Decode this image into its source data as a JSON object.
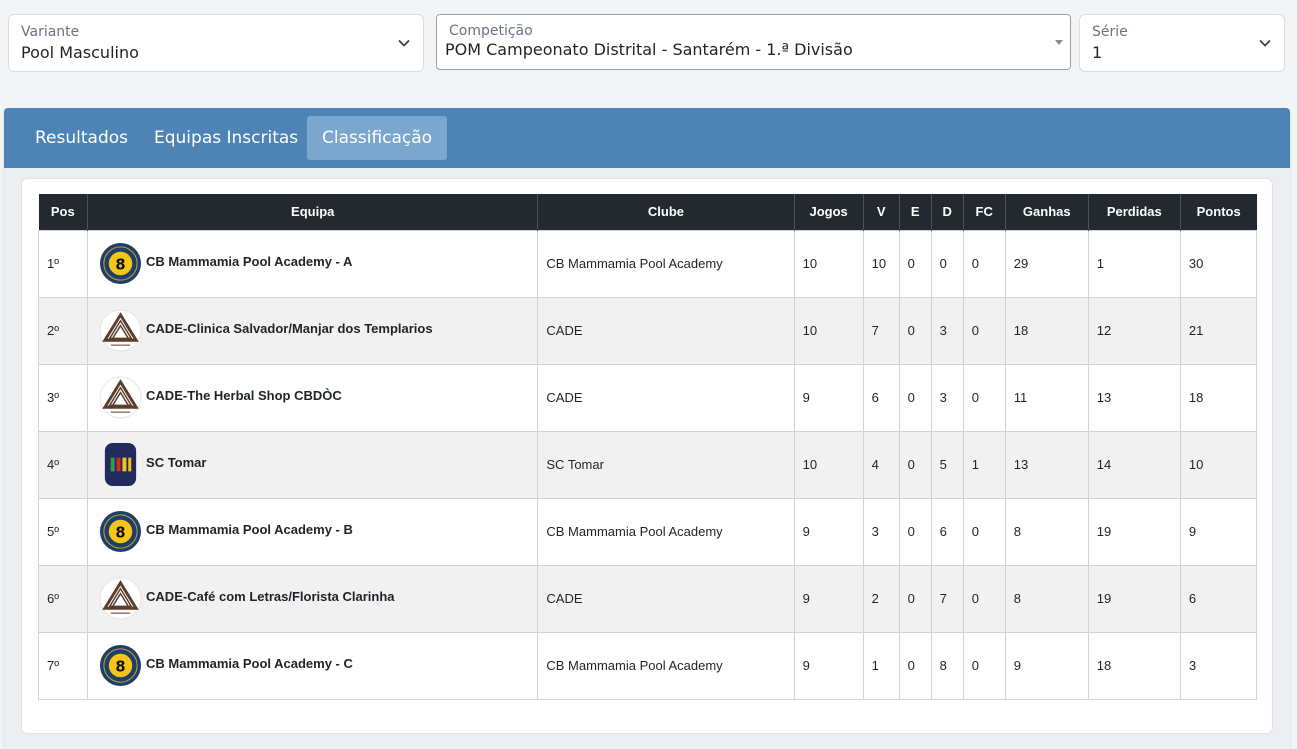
{
  "filters": {
    "variante": {
      "label": "Variante",
      "value": "Pool Masculino"
    },
    "competicao": {
      "label": "Competição",
      "value": "POM Campeonato Distrital - Santarém - 1.ª Divisão"
    },
    "serie": {
      "label": "Série",
      "value": "1"
    }
  },
  "tabs": [
    {
      "label": "Resultados",
      "active": false
    },
    {
      "label": "Equipas Inscritas",
      "active": false
    },
    {
      "label": "Classificação",
      "active": true
    }
  ],
  "table": {
    "headers": [
      "Pos",
      "Equipa",
      "Clube",
      "Jogos",
      "V",
      "E",
      "D",
      "FC",
      "Ganhas",
      "Perdidas",
      "Pontos"
    ],
    "rows": [
      {
        "pos": "1º",
        "team": "CB Mammamia Pool Academy - A",
        "logo": "mammamia-logo",
        "club": "CB Mammamia Pool Academy",
        "jogos": "10",
        "v": "10",
        "e": "0",
        "d": "0",
        "fc": "0",
        "ganhas": "29",
        "perdidas": "1",
        "pontos": "30"
      },
      {
        "pos": "2º",
        "team": "CADE-Clinica Salvador/Manjar dos Templarios",
        "logo": "cade-logo",
        "club": "CADE",
        "jogos": "10",
        "v": "7",
        "e": "0",
        "d": "3",
        "fc": "0",
        "ganhas": "18",
        "perdidas": "12",
        "pontos": "21"
      },
      {
        "pos": "3º",
        "team": "CADE-The Herbal Shop CBDÒC",
        "logo": "cade-logo",
        "club": "CADE",
        "jogos": "9",
        "v": "6",
        "e": "0",
        "d": "3",
        "fc": "0",
        "ganhas": "11",
        "perdidas": "13",
        "pontos": "18"
      },
      {
        "pos": "4º",
        "team": "SC Tomar",
        "logo": "fpb-logo",
        "club": "SC Tomar",
        "jogos": "10",
        "v": "4",
        "e": "0",
        "d": "5",
        "fc": "1",
        "ganhas": "13",
        "perdidas": "14",
        "pontos": "10"
      },
      {
        "pos": "5º",
        "team": "CB Mammamia Pool Academy - B",
        "logo": "mammamia-logo",
        "club": "CB Mammamia Pool Academy",
        "jogos": "9",
        "v": "3",
        "e": "0",
        "d": "6",
        "fc": "0",
        "ganhas": "8",
        "perdidas": "19",
        "pontos": "9"
      },
      {
        "pos": "6º",
        "team": "CADE-Café com Letras/Florista Clarinha",
        "logo": "cade-logo",
        "club": "CADE",
        "jogos": "9",
        "v": "2",
        "e": "0",
        "d": "7",
        "fc": "0",
        "ganhas": "8",
        "perdidas": "19",
        "pontos": "6"
      },
      {
        "pos": "7º",
        "team": "CB Mammamia Pool Academy - C",
        "logo": "mammamia-logo",
        "club": "CB Mammamia Pool Academy",
        "jogos": "9",
        "v": "1",
        "e": "0",
        "d": "8",
        "fc": "0",
        "ganhas": "9",
        "perdidas": "18",
        "pontos": "3"
      }
    ]
  },
  "colors": {
    "tabbar": "#4e84b5",
    "active_tab": "#7ba6ce",
    "table_header": "#24292f",
    "row_alt": "#f1f1f1"
  }
}
